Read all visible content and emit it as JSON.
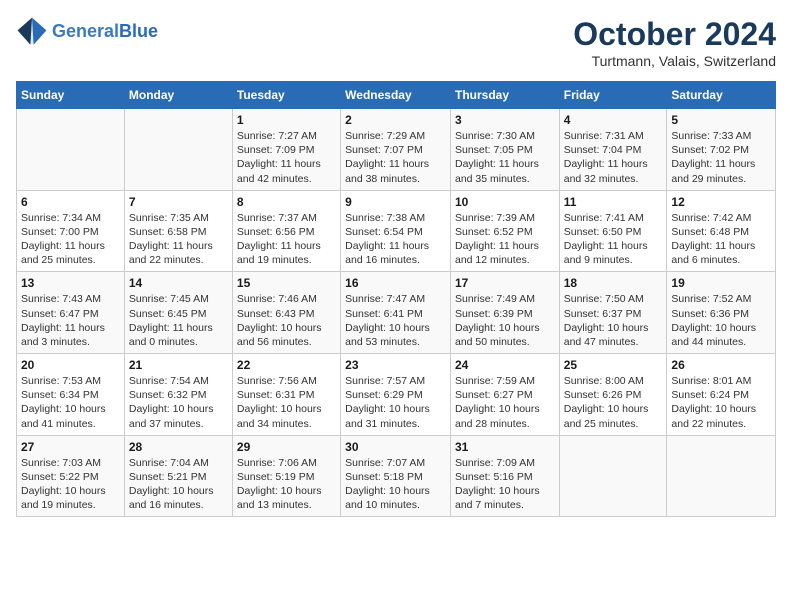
{
  "header": {
    "logo_line1": "General",
    "logo_line2": "Blue",
    "month": "October 2024",
    "location": "Turtmann, Valais, Switzerland"
  },
  "weekdays": [
    "Sunday",
    "Monday",
    "Tuesday",
    "Wednesday",
    "Thursday",
    "Friday",
    "Saturday"
  ],
  "weeks": [
    [
      {
        "day": "",
        "sunrise": "",
        "sunset": "",
        "daylight": ""
      },
      {
        "day": "",
        "sunrise": "",
        "sunset": "",
        "daylight": ""
      },
      {
        "day": "1",
        "sunrise": "Sunrise: 7:27 AM",
        "sunset": "Sunset: 7:09 PM",
        "daylight": "Daylight: 11 hours and 42 minutes."
      },
      {
        "day": "2",
        "sunrise": "Sunrise: 7:29 AM",
        "sunset": "Sunset: 7:07 PM",
        "daylight": "Daylight: 11 hours and 38 minutes."
      },
      {
        "day": "3",
        "sunrise": "Sunrise: 7:30 AM",
        "sunset": "Sunset: 7:05 PM",
        "daylight": "Daylight: 11 hours and 35 minutes."
      },
      {
        "day": "4",
        "sunrise": "Sunrise: 7:31 AM",
        "sunset": "Sunset: 7:04 PM",
        "daylight": "Daylight: 11 hours and 32 minutes."
      },
      {
        "day": "5",
        "sunrise": "Sunrise: 7:33 AM",
        "sunset": "Sunset: 7:02 PM",
        "daylight": "Daylight: 11 hours and 29 minutes."
      }
    ],
    [
      {
        "day": "6",
        "sunrise": "Sunrise: 7:34 AM",
        "sunset": "Sunset: 7:00 PM",
        "daylight": "Daylight: 11 hours and 25 minutes."
      },
      {
        "day": "7",
        "sunrise": "Sunrise: 7:35 AM",
        "sunset": "Sunset: 6:58 PM",
        "daylight": "Daylight: 11 hours and 22 minutes."
      },
      {
        "day": "8",
        "sunrise": "Sunrise: 7:37 AM",
        "sunset": "Sunset: 6:56 PM",
        "daylight": "Daylight: 11 hours and 19 minutes."
      },
      {
        "day": "9",
        "sunrise": "Sunrise: 7:38 AM",
        "sunset": "Sunset: 6:54 PM",
        "daylight": "Daylight: 11 hours and 16 minutes."
      },
      {
        "day": "10",
        "sunrise": "Sunrise: 7:39 AM",
        "sunset": "Sunset: 6:52 PM",
        "daylight": "Daylight: 11 hours and 12 minutes."
      },
      {
        "day": "11",
        "sunrise": "Sunrise: 7:41 AM",
        "sunset": "Sunset: 6:50 PM",
        "daylight": "Daylight: 11 hours and 9 minutes."
      },
      {
        "day": "12",
        "sunrise": "Sunrise: 7:42 AM",
        "sunset": "Sunset: 6:48 PM",
        "daylight": "Daylight: 11 hours and 6 minutes."
      }
    ],
    [
      {
        "day": "13",
        "sunrise": "Sunrise: 7:43 AM",
        "sunset": "Sunset: 6:47 PM",
        "daylight": "Daylight: 11 hours and 3 minutes."
      },
      {
        "day": "14",
        "sunrise": "Sunrise: 7:45 AM",
        "sunset": "Sunset: 6:45 PM",
        "daylight": "Daylight: 11 hours and 0 minutes."
      },
      {
        "day": "15",
        "sunrise": "Sunrise: 7:46 AM",
        "sunset": "Sunset: 6:43 PM",
        "daylight": "Daylight: 10 hours and 56 minutes."
      },
      {
        "day": "16",
        "sunrise": "Sunrise: 7:47 AM",
        "sunset": "Sunset: 6:41 PM",
        "daylight": "Daylight: 10 hours and 53 minutes."
      },
      {
        "day": "17",
        "sunrise": "Sunrise: 7:49 AM",
        "sunset": "Sunset: 6:39 PM",
        "daylight": "Daylight: 10 hours and 50 minutes."
      },
      {
        "day": "18",
        "sunrise": "Sunrise: 7:50 AM",
        "sunset": "Sunset: 6:37 PM",
        "daylight": "Daylight: 10 hours and 47 minutes."
      },
      {
        "day": "19",
        "sunrise": "Sunrise: 7:52 AM",
        "sunset": "Sunset: 6:36 PM",
        "daylight": "Daylight: 10 hours and 44 minutes."
      }
    ],
    [
      {
        "day": "20",
        "sunrise": "Sunrise: 7:53 AM",
        "sunset": "Sunset: 6:34 PM",
        "daylight": "Daylight: 10 hours and 41 minutes."
      },
      {
        "day": "21",
        "sunrise": "Sunrise: 7:54 AM",
        "sunset": "Sunset: 6:32 PM",
        "daylight": "Daylight: 10 hours and 37 minutes."
      },
      {
        "day": "22",
        "sunrise": "Sunrise: 7:56 AM",
        "sunset": "Sunset: 6:31 PM",
        "daylight": "Daylight: 10 hours and 34 minutes."
      },
      {
        "day": "23",
        "sunrise": "Sunrise: 7:57 AM",
        "sunset": "Sunset: 6:29 PM",
        "daylight": "Daylight: 10 hours and 31 minutes."
      },
      {
        "day": "24",
        "sunrise": "Sunrise: 7:59 AM",
        "sunset": "Sunset: 6:27 PM",
        "daylight": "Daylight: 10 hours and 28 minutes."
      },
      {
        "day": "25",
        "sunrise": "Sunrise: 8:00 AM",
        "sunset": "Sunset: 6:26 PM",
        "daylight": "Daylight: 10 hours and 25 minutes."
      },
      {
        "day": "26",
        "sunrise": "Sunrise: 8:01 AM",
        "sunset": "Sunset: 6:24 PM",
        "daylight": "Daylight: 10 hours and 22 minutes."
      }
    ],
    [
      {
        "day": "27",
        "sunrise": "Sunrise: 7:03 AM",
        "sunset": "Sunset: 5:22 PM",
        "daylight": "Daylight: 10 hours and 19 minutes."
      },
      {
        "day": "28",
        "sunrise": "Sunrise: 7:04 AM",
        "sunset": "Sunset: 5:21 PM",
        "daylight": "Daylight: 10 hours and 16 minutes."
      },
      {
        "day": "29",
        "sunrise": "Sunrise: 7:06 AM",
        "sunset": "Sunset: 5:19 PM",
        "daylight": "Daylight: 10 hours and 13 minutes."
      },
      {
        "day": "30",
        "sunrise": "Sunrise: 7:07 AM",
        "sunset": "Sunset: 5:18 PM",
        "daylight": "Daylight: 10 hours and 10 minutes."
      },
      {
        "day": "31",
        "sunrise": "Sunrise: 7:09 AM",
        "sunset": "Sunset: 5:16 PM",
        "daylight": "Daylight: 10 hours and 7 minutes."
      },
      {
        "day": "",
        "sunrise": "",
        "sunset": "",
        "daylight": ""
      },
      {
        "day": "",
        "sunrise": "",
        "sunset": "",
        "daylight": ""
      }
    ]
  ]
}
